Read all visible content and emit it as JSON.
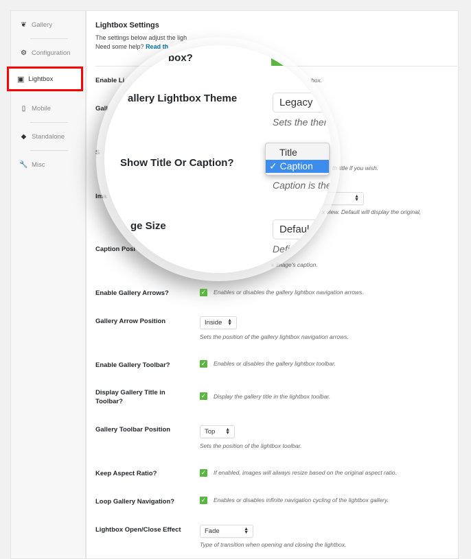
{
  "sidebar": {
    "items": [
      {
        "label": "Gallery",
        "icon": "leaf-icon"
      },
      {
        "label": "Configuration",
        "icon": "gear-icon"
      },
      {
        "label": "Lightbox",
        "icon": "lightbox-icon",
        "active": true
      },
      {
        "label": "Mobile",
        "icon": "mobile-icon"
      },
      {
        "label": "Standalone",
        "icon": "standalone-icon"
      },
      {
        "label": "Misc",
        "icon": "wrench-icon"
      }
    ]
  },
  "header": {
    "title": "Lightbox Settings",
    "intro": "The settings below adjust the ligh",
    "help_prefix": "Need some help?",
    "help_link": "Read th"
  },
  "background_fragments": {
    "enable_label": "Enable Li",
    "enable_desc": "box.",
    "theme_label": "Gall",
    "title_label": "S",
    "title_desc": "th title if you wish.",
    "image_label": "Ima",
    "image_desc": "x view. Default will display the original,",
    "caption_label": "Caption Posi",
    "caption_desc": "x image's caption."
  },
  "magnifier": {
    "enable_label": "box?",
    "theme_label": "allery Lightbox Theme",
    "theme_value": "Legacy",
    "theme_desc": "Sets the then",
    "title_label": "Show Title Or Caption?",
    "title_options": [
      "Title",
      "Caption"
    ],
    "title_selected": "Caption",
    "title_desc": "Caption is the",
    "size_label": "ge Size",
    "size_value": "Defaul",
    "size_desc": "Defi",
    "accent": "#3b8ced"
  },
  "rows": {
    "arrows": {
      "label": "Enable Gallery Arrows?",
      "checked": true,
      "desc": "Enables or disables the gallery lightbox navigation arrows."
    },
    "arrow_pos": {
      "label": "Gallery Arrow Position",
      "value": "Inside",
      "desc": "Sets the position of the gallery lightbox navigation arrows."
    },
    "toolbar": {
      "label": "Enable Gallery Toolbar?",
      "checked": true,
      "desc": "Enables or disables the gallery lightbox toolbar."
    },
    "toolbar_title": {
      "label1": "Display Gallery Title in",
      "label2": "Toolbar?",
      "checked": true,
      "desc": "Display the gallery title in the lightbox toolbar."
    },
    "toolbar_pos": {
      "label": "Gallery Toolbar Position",
      "value": "Top",
      "desc": "Sets the position of the lightbox toolbar."
    },
    "aspect": {
      "label": "Keep Aspect Ratio?",
      "checked": true,
      "desc": "If enabled, images will always resize based on the original aspect ratio."
    },
    "loop": {
      "label": "Loop Gallery Navigation?",
      "checked": true,
      "desc": "Enables or disables infinite navigation cycling of the lightbox gallery."
    },
    "effect": {
      "label": "Lightbox Open/Close Effect",
      "value": "Fade",
      "desc": "Type of transition when opening and closing the lightbox."
    }
  },
  "colors": {
    "checkbox": "#5ab543",
    "highlight": "#ff0000",
    "link": "#0073aa"
  }
}
